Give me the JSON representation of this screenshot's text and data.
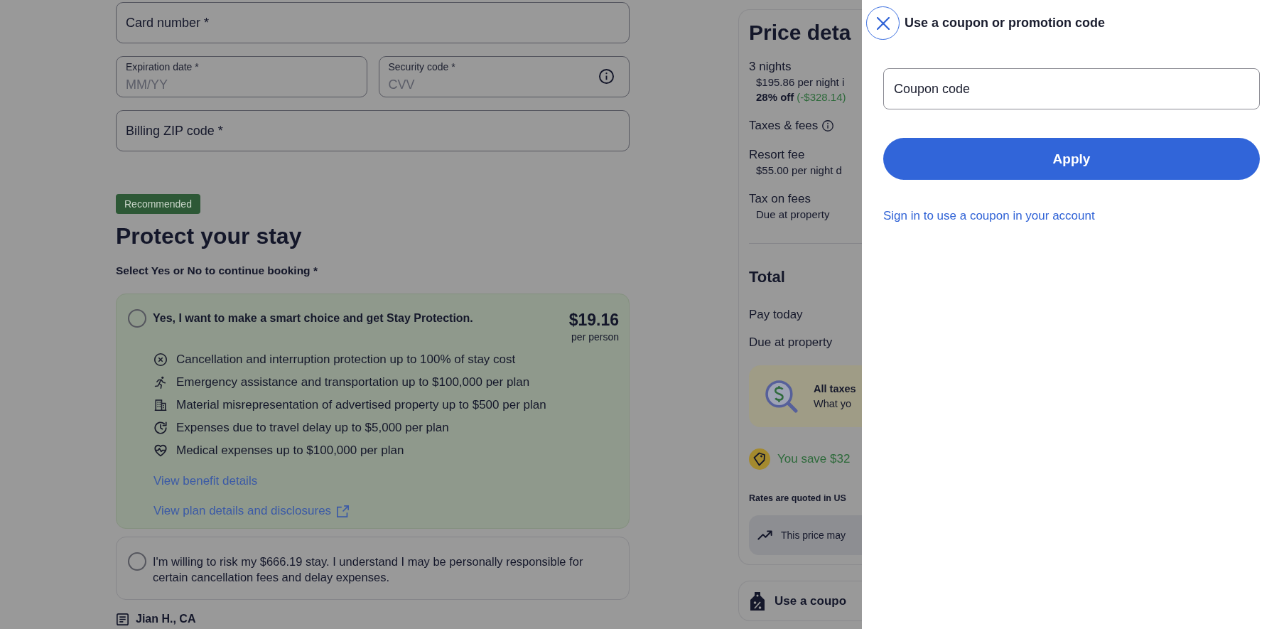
{
  "payment_form": {
    "rows": [
      [
        {
          "placeholder": "Card number *",
          "info": false
        }
      ],
      [
        {
          "label": "Expiration date *",
          "placeholder": "MM/YY",
          "info": false
        },
        {
          "label": "Security code *",
          "placeholder": "CVV",
          "info": true
        }
      ],
      [
        {
          "placeholder": "Billing ZIP code *",
          "info": false
        }
      ]
    ]
  },
  "protection": {
    "badge": "Recommended",
    "title": "Protect your stay",
    "prompt": "Select Yes or No to continue booking *",
    "options": [
      {
        "kind": "plan",
        "selected": false,
        "label": "Yes, I want to make a smart choice and get Stay Protection.",
        "price": "$19.16",
        "price_unit": "per person",
        "benefits": [
          "Cancellation and interruption protection up to 100% of stay cost",
          "Emergency assistance and transportation up to $100,000 per plan",
          "Material misrepresentation of advertised property up to $500 per plan",
          "Expenses due to travel delay up to $5,000 per plan",
          "Medical expenses up to $100,000 per plan"
        ],
        "links": [
          {
            "text": "View benefit details",
            "external": false
          },
          {
            "text": "View plan details and disclosures",
            "external": true
          }
        ]
      },
      {
        "kind": "decline",
        "selected": false,
        "label": "I'm willing to risk my $666.19 stay. I understand I may be personally responsible for certain cancellation fees and delay expenses."
      }
    ]
  },
  "review": {
    "author": "Jian H., CA"
  },
  "price_details": {
    "title": "Price deta",
    "items": [
      {
        "label": "3 nights",
        "detail": "$195.86 per night i",
        "discount": "28% off",
        "saving": "(-$328.14)",
        "info": false
      },
      {
        "label": "Taxes & fees",
        "info": true
      },
      {
        "label": "Resort fee",
        "detail": "$55.00 per night d",
        "info": false
      },
      {
        "label": "Tax on fees",
        "detail": "Due at property",
        "info": false
      }
    ],
    "total_title": "Total",
    "totals": [
      "Pay today",
      "Due at property"
    ],
    "notice": {
      "title": "All taxes",
      "text": "What yo"
    },
    "savings": "You save $32",
    "currency_note": "Rates are quoted in US",
    "price_trend": "This price may"
  },
  "coupon_card": {
    "label": "Use a coupo"
  },
  "coupon_dialog": {
    "title": "Use a coupon or promotion code",
    "field": {
      "placeholder": "Coupon code"
    },
    "button": "Apply",
    "link": "Sign in to use a coupon in your account"
  }
}
